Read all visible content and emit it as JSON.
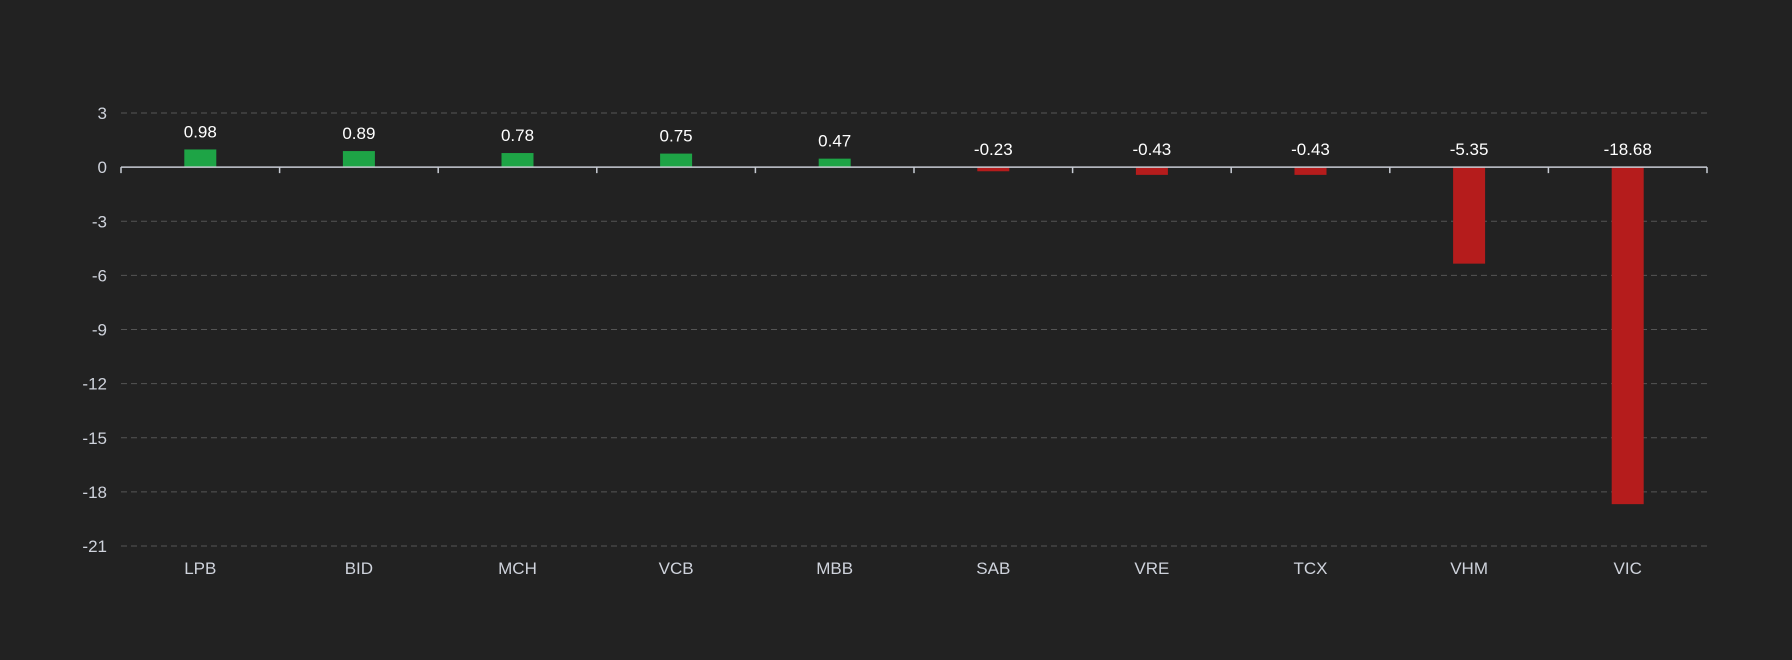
{
  "chart_data": {
    "type": "bar",
    "categories": [
      "LPB",
      "BID",
      "MCH",
      "VCB",
      "MBB",
      "SAB",
      "VRE",
      "TCX",
      "VHM",
      "VIC"
    ],
    "values": [
      0.98,
      0.89,
      0.78,
      0.75,
      0.47,
      -0.23,
      -0.43,
      -0.43,
      -5.35,
      -18.68
    ],
    "value_labels": [
      "0.98",
      "0.89",
      "0.78",
      "0.75",
      "0.47",
      "-0.23",
      "-0.43",
      "-0.43",
      "-5.35",
      "-18.68"
    ],
    "ylim": [
      -21,
      3
    ],
    "yticks": [
      3,
      0,
      -3,
      -6,
      -9,
      -12,
      -15,
      -18,
      -21
    ],
    "grid": true,
    "title": "",
    "xlabel": "",
    "ylabel": "",
    "colors": {
      "positive": "#1ea446",
      "negative": "#b51c1c",
      "background": "#222222",
      "grid": "#555555",
      "axis": "#c8ccd4",
      "tick_text": "#cfd3dc",
      "label_text": "#ffffff"
    }
  }
}
